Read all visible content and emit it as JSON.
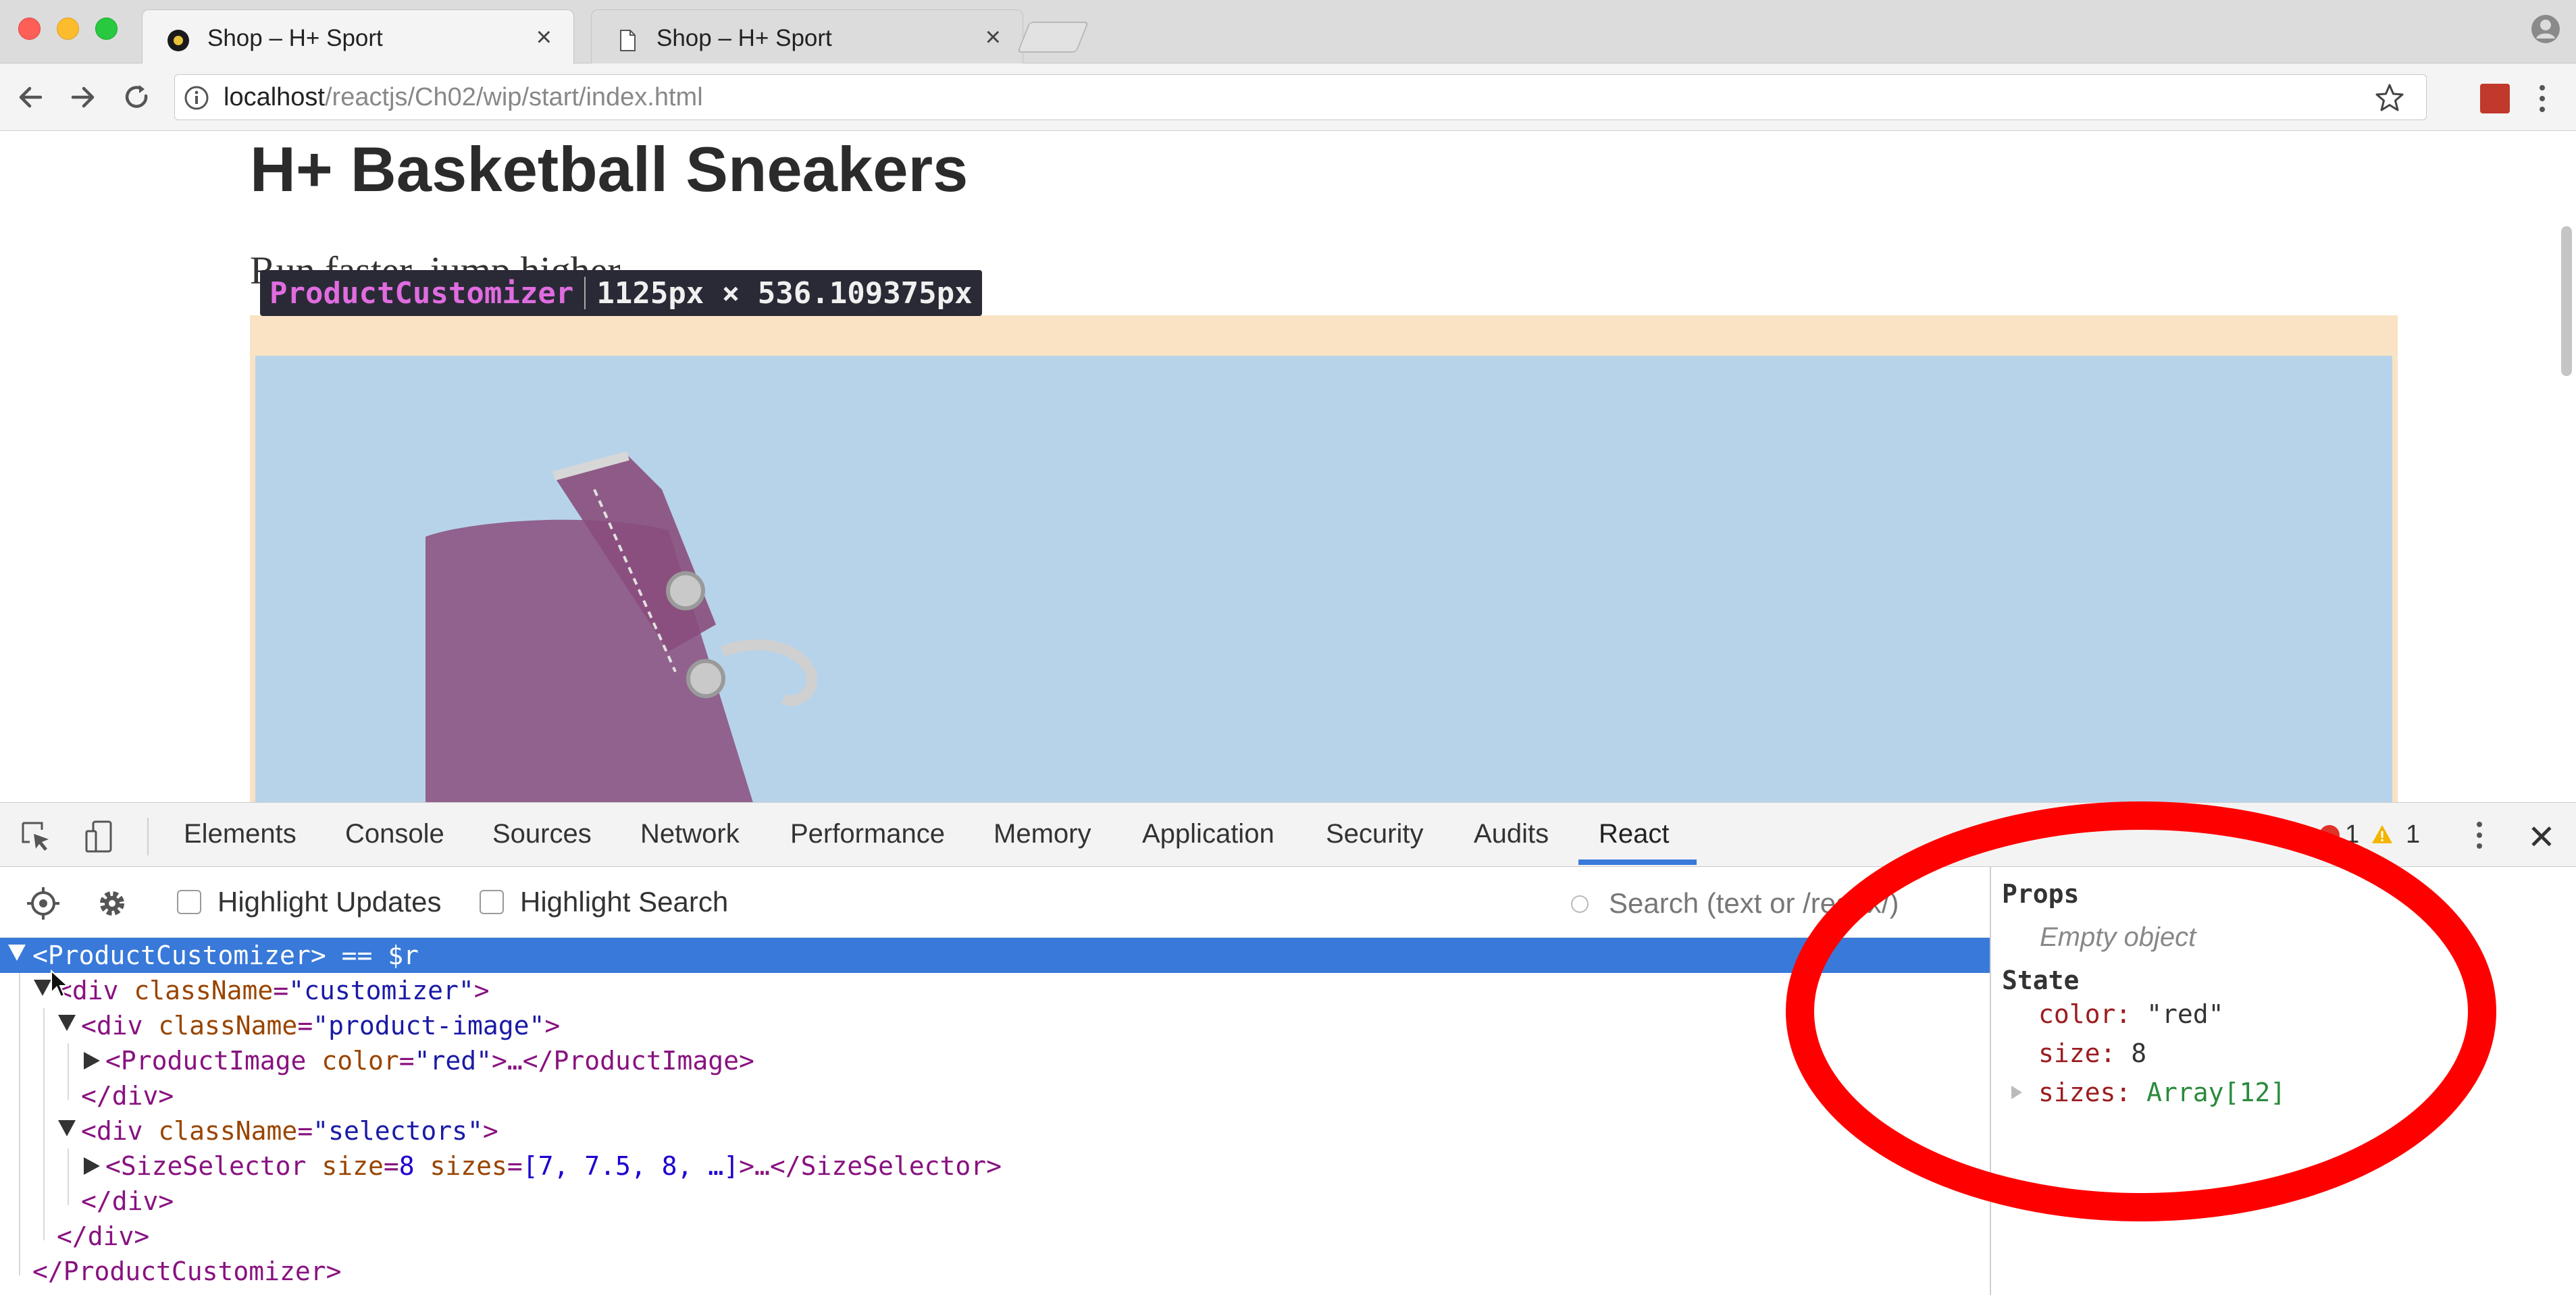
{
  "browser": {
    "tabs": [
      {
        "title": "Shop – H+ Sport",
        "active": true
      },
      {
        "title": "Shop – H+ Sport",
        "active": false
      }
    ],
    "url_host": "localhost",
    "url_path": "/reactjs/Ch02/wip/start/index.html",
    "icons": {
      "back": "arrow-left-icon",
      "forward": "arrow-right-icon",
      "reload": "reload-icon",
      "info": "info-icon",
      "bookmark": "star-icon",
      "extension": "extension-icon",
      "menu": "vertical-dots-icon",
      "profile": "profile-icon"
    }
  },
  "page": {
    "title": "H+ Basketball Sneakers",
    "subtitle": "Run faster, jump higher",
    "inspect_tooltip": {
      "component": "ProductCustomizer",
      "dimensions": "1125px × 536.109375px"
    },
    "colors": {
      "highlight_margin": "#f9e3c4",
      "highlight_content": "#b7d3ea"
    }
  },
  "devtools": {
    "tabs": [
      "Elements",
      "Console",
      "Sources",
      "Network",
      "Performance",
      "Memory",
      "Application",
      "Security",
      "Audits",
      "React"
    ],
    "active_tab": "React",
    "error_count": "1",
    "warning_count": "1",
    "toolbar": {
      "highlight_updates_label": "Highlight Updates",
      "highlight_search_label": "Highlight Search",
      "search_placeholder": "Search (text or /regex/)"
    },
    "tree": {
      "row0": {
        "open": "<",
        "name": "ProductCustomizer",
        "close": ">",
        "suffix": " == $r"
      },
      "row1": {
        "tag": "<div",
        "attr": "className",
        "eq": "=",
        "val": "\"customizer\"",
        "end": ">"
      },
      "row2": {
        "tag": "<div",
        "attr": "className",
        "eq": "=",
        "val": "\"product-image\"",
        "end": ">"
      },
      "row3": {
        "tag": "<ProductImage",
        "attr": "color",
        "eq": "=",
        "val": "\"red\"",
        "end": ">…</ProductImage>"
      },
      "row4": {
        "text": "</div>"
      },
      "row5": {
        "tag": "<div",
        "attr": "className",
        "eq": "=",
        "val": "\"selectors\"",
        "end": ">"
      },
      "row6": {
        "tag": "<SizeSelector",
        "attr1": "size",
        "eq1": "=",
        "val1": "8",
        "attr2": "sizes",
        "eq2": "=",
        "val2": "[7, 7.5, 8, …]",
        "end": ">…</SizeSelector>"
      },
      "row7": {
        "text": "</div>"
      },
      "row8": {
        "text": "</div>"
      },
      "row9": {
        "text": "</ProductCustomizer>"
      }
    },
    "side_panel": {
      "props_heading": "Props",
      "props_empty": "Empty object",
      "state_heading": "State",
      "state": [
        {
          "key": "color",
          "sep": ":",
          "value": "\"red\""
        },
        {
          "key": "size",
          "sep": ":",
          "value": "8"
        },
        {
          "key": "sizes",
          "sep": ":",
          "value": "Array[12]"
        }
      ]
    }
  },
  "annotation": {
    "color": "#ff0000",
    "shape": "ellipse"
  }
}
